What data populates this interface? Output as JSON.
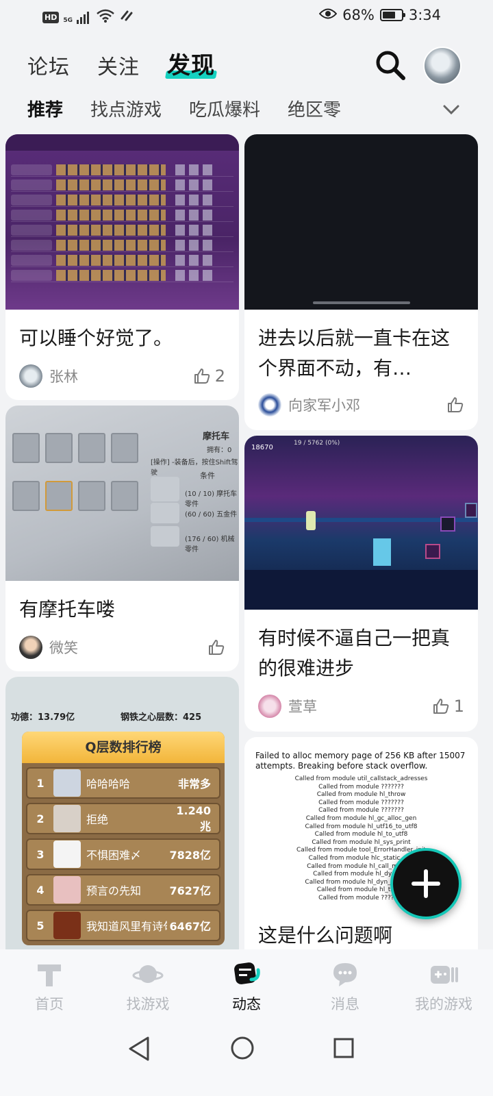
{
  "status_bar": {
    "hd": "HD",
    "signal_label": "5G",
    "battery_text": "68%",
    "battery_level": 0.68,
    "time": "3:34"
  },
  "top_nav": {
    "tabs": [
      {
        "label": "论坛",
        "active": false
      },
      {
        "label": "关注",
        "active": false
      },
      {
        "label": "发现",
        "active": true
      }
    ],
    "search_icon": "search-icon",
    "avatar_icon": "user-avatar"
  },
  "sub_nav": {
    "chips": [
      {
        "label": "推荐",
        "active": true
      },
      {
        "label": "找点游戏",
        "active": false
      },
      {
        "label": "吃瓜爆料",
        "active": false
      },
      {
        "label": "绝区零",
        "active": false
      }
    ],
    "more_icon": "chevron-down-icon"
  },
  "feed": {
    "left": [
      {
        "title": "可以睡个好觉了。",
        "author": "张林",
        "likes": "2"
      },
      {
        "title": "有摩托车喽",
        "author": "微笑",
        "likes": ""
      },
      {
        "title": "",
        "author": "",
        "likes": ""
      }
    ],
    "right": [
      {
        "title": "进去以后就一直卡在这个界面不动，有…",
        "author": "向家军小邓",
        "likes": ""
      },
      {
        "title": "有时候不逼自己一把真的很难进步",
        "author": "萱草",
        "likes": "1"
      },
      {
        "title": "这是什么问题啊",
        "author": "",
        "likes": ""
      }
    ]
  },
  "image_text": {
    "moto": {
      "name": "摩托车",
      "owned": "拥有：0",
      "hint": "[操作] -装备后，按住Shift驾驶",
      "cond": "条件",
      "req1": "(10 / 10) 摩托车零件",
      "req2": "(60 / 60) 五金件",
      "req3": "(176 / 60) 机械零件"
    },
    "game": {
      "count": "18670",
      "progress": "19 / 5762 (0%)"
    },
    "rank": {
      "stat1": "功德：13.79亿",
      "stat2": "钢铁之心层数：425",
      "board_title": "Q层数排行榜",
      "rows": [
        {
          "n": "1",
          "name": "哈哈哈哈",
          "val": "非常多"
        },
        {
          "n": "2",
          "name": "拒绝",
          "val": "1.240兆"
        },
        {
          "n": "3",
          "name": "不惧困难〆",
          "val": "7828亿"
        },
        {
          "n": "4",
          "name": "预言の先知",
          "val": "7627亿"
        },
        {
          "n": "5",
          "name": "我知道风里有诗句",
          "val": "6467亿"
        }
      ]
    },
    "error": {
      "head": "Failed to alloc memory page of 256 KB after 15007 attempts. Breaking before stack overflow.",
      "lines": [
        "Called from module util_callstack_adresses",
        "Called from module ???????",
        "Called from module hl_throw",
        "Called from module ???????",
        "Called from module ???????",
        "Called from module hl_gc_alloc_gen",
        "Called from module hl_utf16_to_utf8",
        "Called from module hl_to_utf8",
        "Called from module hl_sys_print",
        "Called from module tool_ErrorHandler_init",
        "Called from module hlc_static_call",
        "Called from module hl_call_method",
        "Called from module hl_dyn_call",
        "Called from module hl_dyn_call_safe",
        "Called from module hl_throw",
        "Called from module ???????"
      ]
    }
  },
  "fab": {
    "icon": "plus-icon"
  },
  "tab_bar": {
    "items": [
      {
        "label": "首页",
        "icon": "home-t-icon",
        "active": false
      },
      {
        "label": "找游戏",
        "icon": "planet-icon",
        "active": false
      },
      {
        "label": "动态",
        "icon": "feed-icon",
        "active": true
      },
      {
        "label": "消息",
        "icon": "chat-bubble-icon",
        "active": false
      },
      {
        "label": "我的游戏",
        "icon": "gamepad-icon",
        "active": false
      }
    ]
  },
  "system_nav": {
    "back": "back-triangle-icon",
    "home": "home-circle-icon",
    "recents": "recents-square-icon"
  },
  "colors": {
    "accent": "#15d1c0",
    "background": "#f2f3f5",
    "inactive": "#b5b8bd"
  }
}
